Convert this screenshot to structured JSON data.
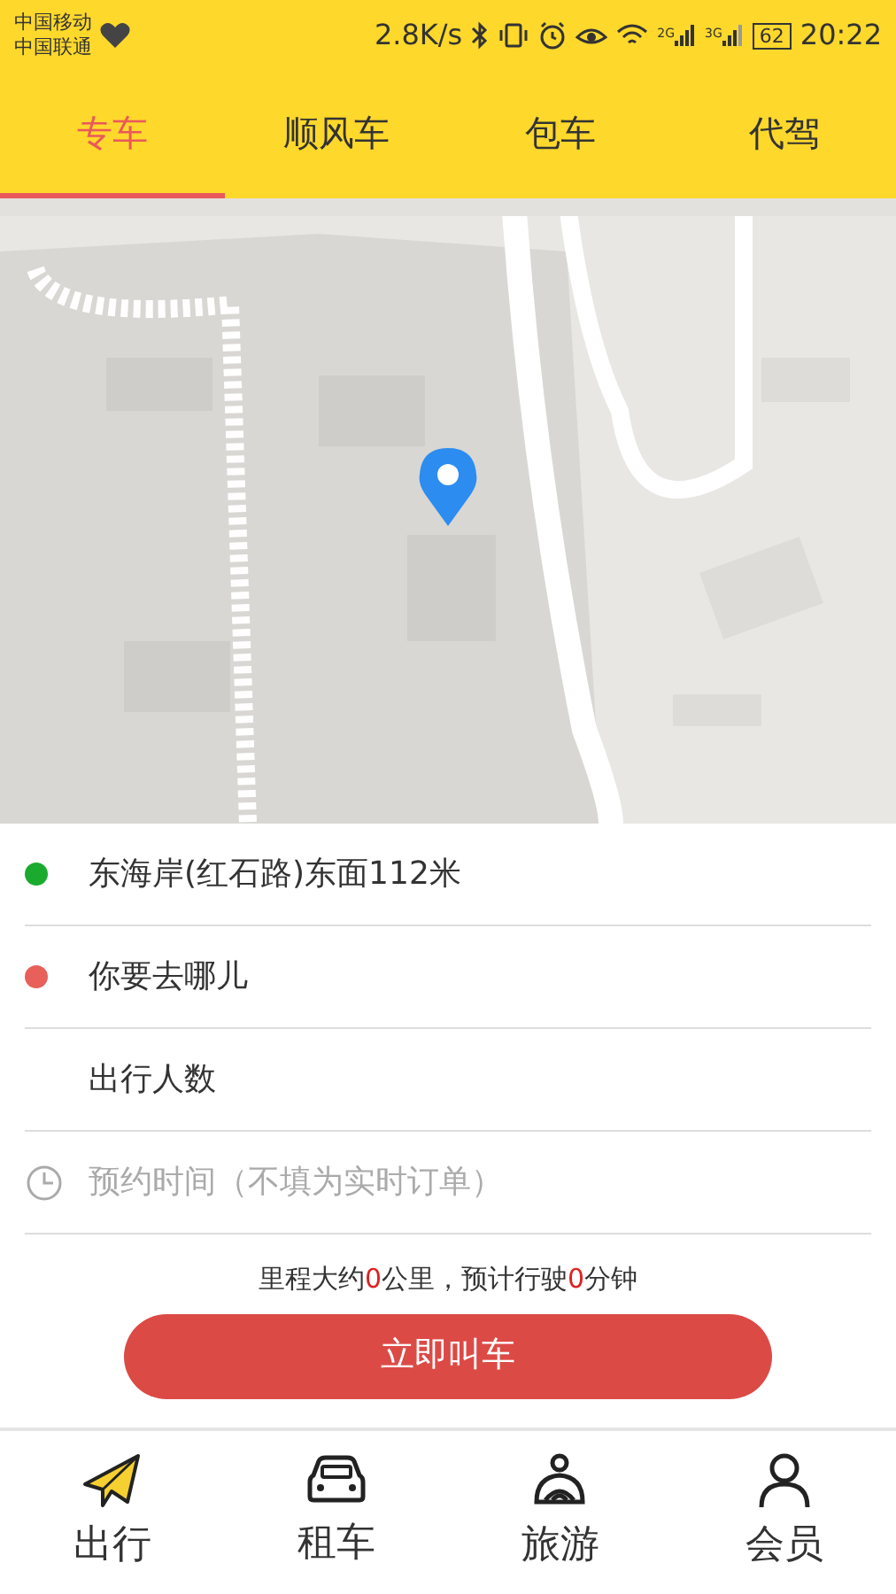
{
  "status_bar": {
    "carriers": [
      "中国移动",
      "中国联通"
    ],
    "speed": "2.8K/s",
    "network_labels": [
      "2G",
      "3G"
    ],
    "battery": "62",
    "time": "20:22"
  },
  "tabs": [
    {
      "label": "专车",
      "selected": true
    },
    {
      "label": "顺风车",
      "selected": false
    },
    {
      "label": "包车",
      "selected": false
    },
    {
      "label": "代驾",
      "selected": false
    }
  ],
  "rows": [
    {
      "kind": "dot",
      "color": "#1aab2e",
      "text": "东海岸(红石路)东面112米",
      "muted": false
    },
    {
      "kind": "dot",
      "color": "#e8605a",
      "text": "你要去哪儿",
      "muted": false
    },
    {
      "kind": "plain",
      "text": "出行人数",
      "muted": false
    },
    {
      "kind": "clock",
      "text": "预约时间（不填为实时订单）",
      "muted": true
    }
  ],
  "estimate": [
    {
      "kind": "plain",
      "text": "里程大约"
    },
    {
      "kind": "highlight",
      "text": "0"
    },
    {
      "kind": "plain",
      "text": "公里，预计行驶"
    },
    {
      "kind": "highlight",
      "text": "0"
    },
    {
      "kind": "plain",
      "text": "分钟"
    }
  ],
  "call_button": "立即叫车",
  "bottom_nav": [
    {
      "kind": "plane",
      "label": "出行",
      "selected": true
    },
    {
      "kind": "car",
      "label": "租车",
      "selected": false
    },
    {
      "kind": "driver",
      "label": "旅游",
      "selected": false
    },
    {
      "kind": "person",
      "label": "会员",
      "selected": false
    }
  ]
}
